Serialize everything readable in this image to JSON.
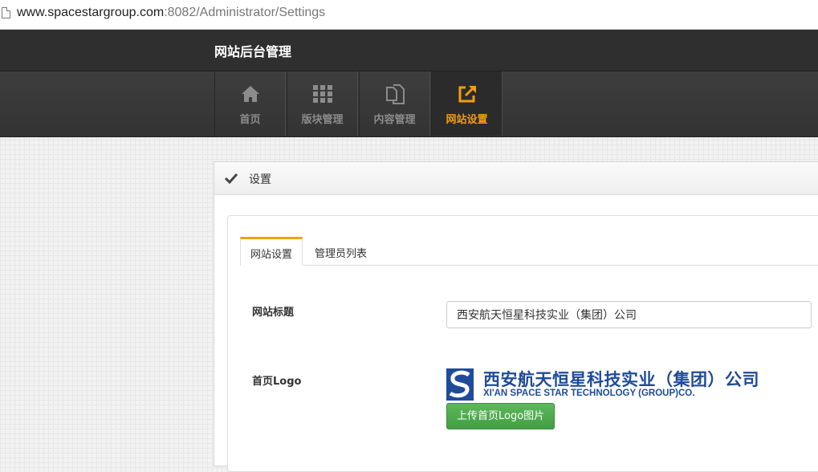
{
  "browser": {
    "url_host": "www.spacestargroup.com",
    "url_path": ":8082/Administrator/Settings"
  },
  "header": {
    "site_title": "网站后台管理"
  },
  "nav": {
    "items": [
      {
        "label": "首页",
        "icon": "home-icon"
      },
      {
        "label": "版块管理",
        "icon": "grid-icon"
      },
      {
        "label": "内容管理",
        "icon": "copy-icon"
      },
      {
        "label": "网站设置",
        "icon": "external-link-icon",
        "active": true
      }
    ]
  },
  "panel": {
    "title": "设置",
    "tabs": [
      {
        "label": "网站设置",
        "active": true
      },
      {
        "label": "管理员列表",
        "active": false
      }
    ],
    "form": {
      "site_title_label": "网站标题",
      "site_title_value": "西安航天恒星科技实业（集团）公司",
      "logo_label": "首页Logo",
      "logo_text_cn": "西安航天恒星科技实业（集团）公司",
      "logo_text_en": "XI'AN SPACE STAR TECHNOLOGY (GROUP)CO.",
      "upload_button": "上传首页Logo图片"
    }
  },
  "colors": {
    "accent": "#f39c12",
    "brand_blue": "#1f4b9a",
    "success": "#5cb85c",
    "topbar": "#2f2f2f"
  }
}
